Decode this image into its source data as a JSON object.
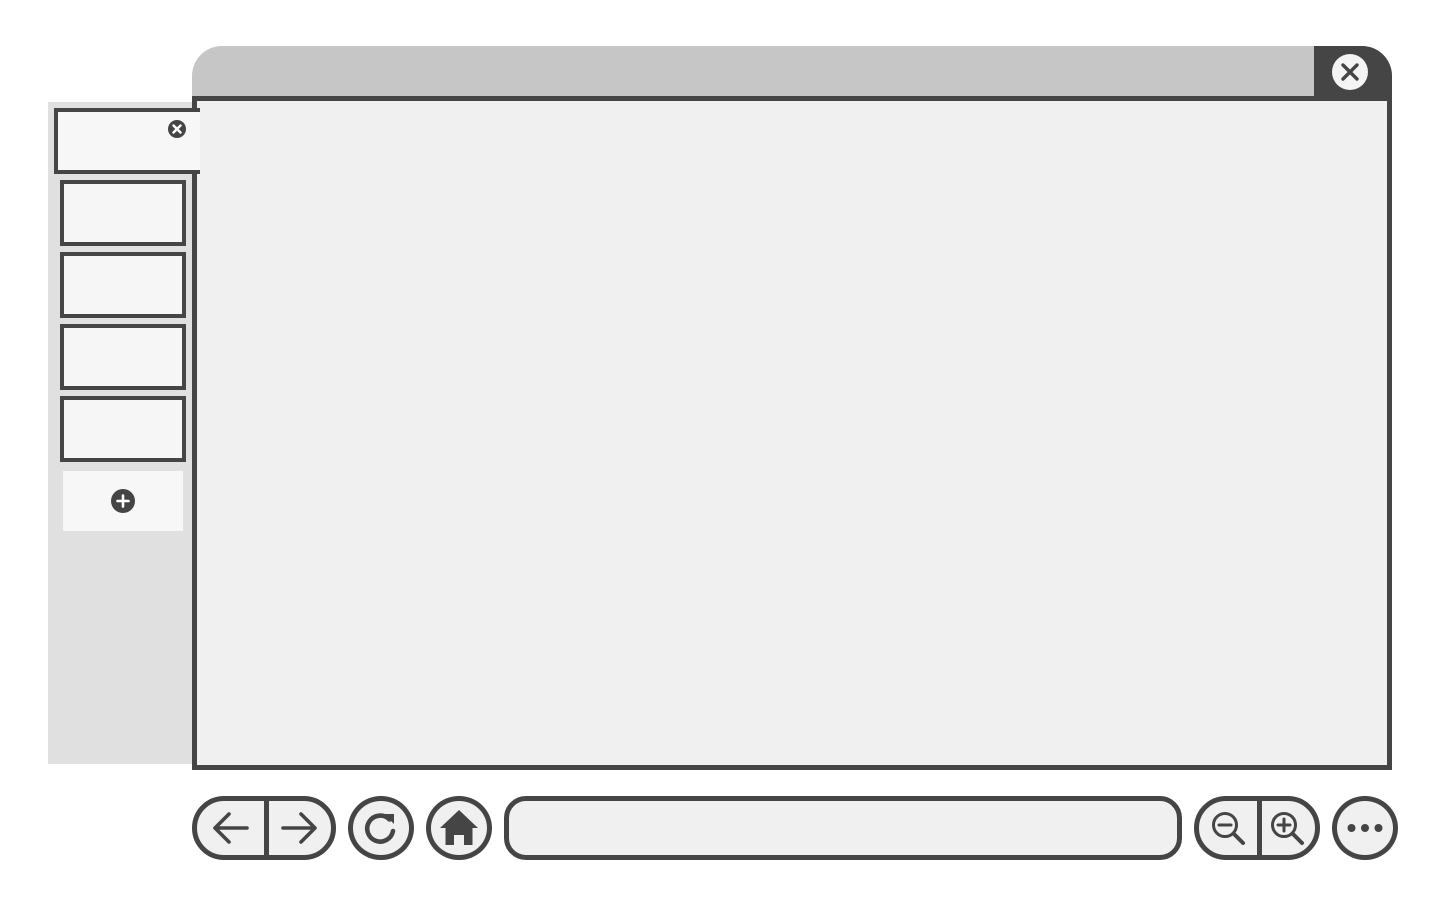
{
  "window": {
    "title": "",
    "close_icon": "close-icon"
  },
  "tabs": {
    "items": [
      {
        "label": "",
        "active": true,
        "close_icon": "close-small-icon"
      },
      {
        "label": "",
        "active": false
      },
      {
        "label": "",
        "active": false
      },
      {
        "label": "",
        "active": false
      },
      {
        "label": "",
        "active": false
      }
    ],
    "add_icon": "plus-circle-icon"
  },
  "toolbar": {
    "back_icon": "arrow-left-icon",
    "forward_icon": "arrow-right-icon",
    "reload_icon": "reload-icon",
    "home_icon": "home-icon",
    "address_value": "",
    "zoom_out_icon": "zoom-out-icon",
    "zoom_in_icon": "zoom-in-icon",
    "more_icon": "more-horizontal-icon"
  },
  "colors": {
    "frame": "#454545",
    "titlebar": "#c6c6c6",
    "sidebar": "#e0e0e0",
    "viewport": "#f0f0f0",
    "tab": "#f6f6f6"
  }
}
